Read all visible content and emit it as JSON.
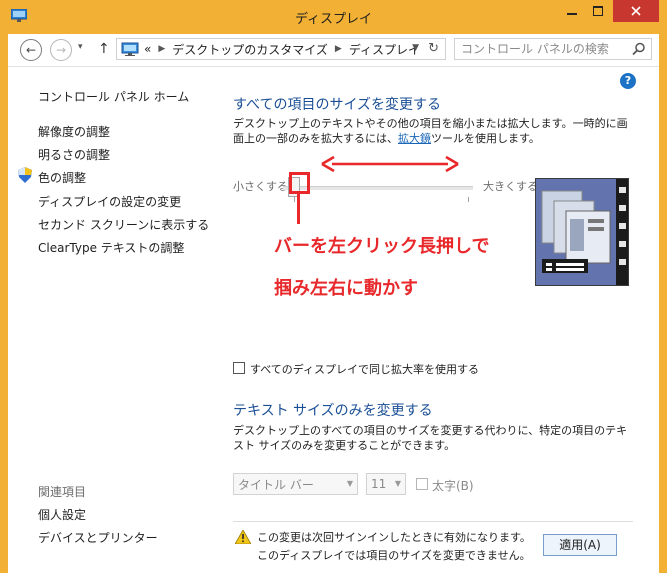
{
  "window": {
    "title": "ディスプレイ",
    "title_bar_color": "#f2b134",
    "close_color": "#c7372f"
  },
  "address": {
    "history_chevron": "▾",
    "crumbs": [
      "«",
      "デスクトップのカスタマイズ",
      "ディスプレイ"
    ],
    "search_placeholder": "コントロール パネルの検索"
  },
  "sidebar": {
    "home": "コントロール パネル ホーム",
    "items": [
      "解像度の調整",
      "明るさの調整",
      "色の調整",
      "ディスプレイの設定の変更",
      "セカンド スクリーンに表示する",
      "ClearType テキストの調整"
    ],
    "related_heading": "関連項目",
    "related": [
      "個人設定",
      "デバイスとプリンター"
    ]
  },
  "main": {
    "heading1": "すべての項目のサイズを変更する",
    "desc1_a": "デスクトップ上のテキストやその他の項目を縮小または拡大します。一時的に画面上の一部のみを拡大するには、",
    "desc1_link": "拡大鏡",
    "desc1_b": "ツールを使用します。",
    "slider": {
      "min_label": "小さくする",
      "max_label": "大きくする",
      "level": 0
    },
    "same_scale_checkbox": "すべてのディスプレイで同じ拡大率を使用する",
    "same_scale_checked": false,
    "heading2": "テキスト サイズのみを変更する",
    "desc2": "デスクトップ上のすべての項目のサイズを変更する代わりに、特定の項目のテキスト サイズのみを変更することができます。",
    "item_select": "タイトル バー",
    "size_select": "11",
    "bold_label": "太字(B)",
    "notice_line1": "この変更は次回サインインしたときに有効になります。",
    "notice_line2": "このディスプレイでは項目のサイズを変更できません。",
    "apply_button": "適用(A)"
  },
  "annotation": {
    "line1": "バーを左クリック長押しで",
    "line2": "掴み左右に動かす",
    "color": "#e8282b"
  }
}
